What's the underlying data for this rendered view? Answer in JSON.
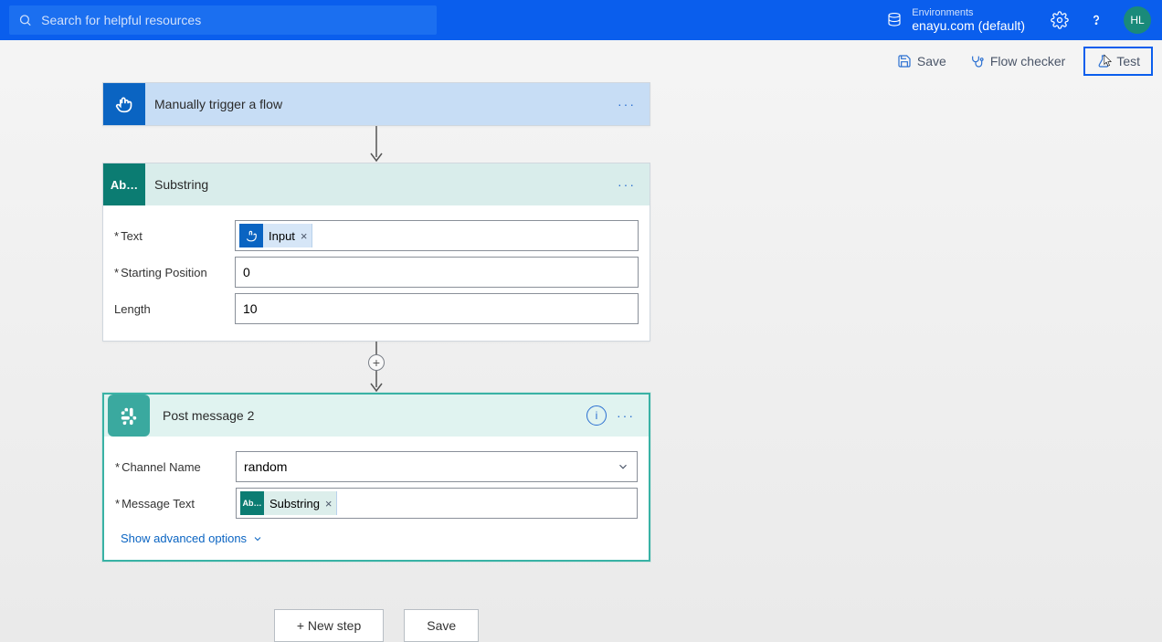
{
  "header": {
    "search_placeholder": "Search for helpful resources",
    "env_label": "Environments",
    "env_name": "enayu.com (default)",
    "avatar": "HL"
  },
  "commands": {
    "save": "Save",
    "flow_checker": "Flow checker",
    "test": "Test"
  },
  "steps": {
    "trigger": {
      "title": "Manually trigger a flow"
    },
    "substring": {
      "title": "Substring",
      "icon_text": "Ab…",
      "fields": {
        "text_label": "Text",
        "text_token": "Input",
        "start_label": "Starting Position",
        "start_value": "0",
        "length_label": "Length",
        "length_value": "10"
      }
    },
    "post": {
      "title": "Post message 2",
      "fields": {
        "channel_label": "Channel Name",
        "channel_value": "random",
        "message_label": "Message Text",
        "message_token": "Substring",
        "message_token_icon": "Ab…"
      },
      "show_advanced": "Show advanced options"
    }
  },
  "footer": {
    "new_step": "+ New step",
    "save": "Save"
  }
}
